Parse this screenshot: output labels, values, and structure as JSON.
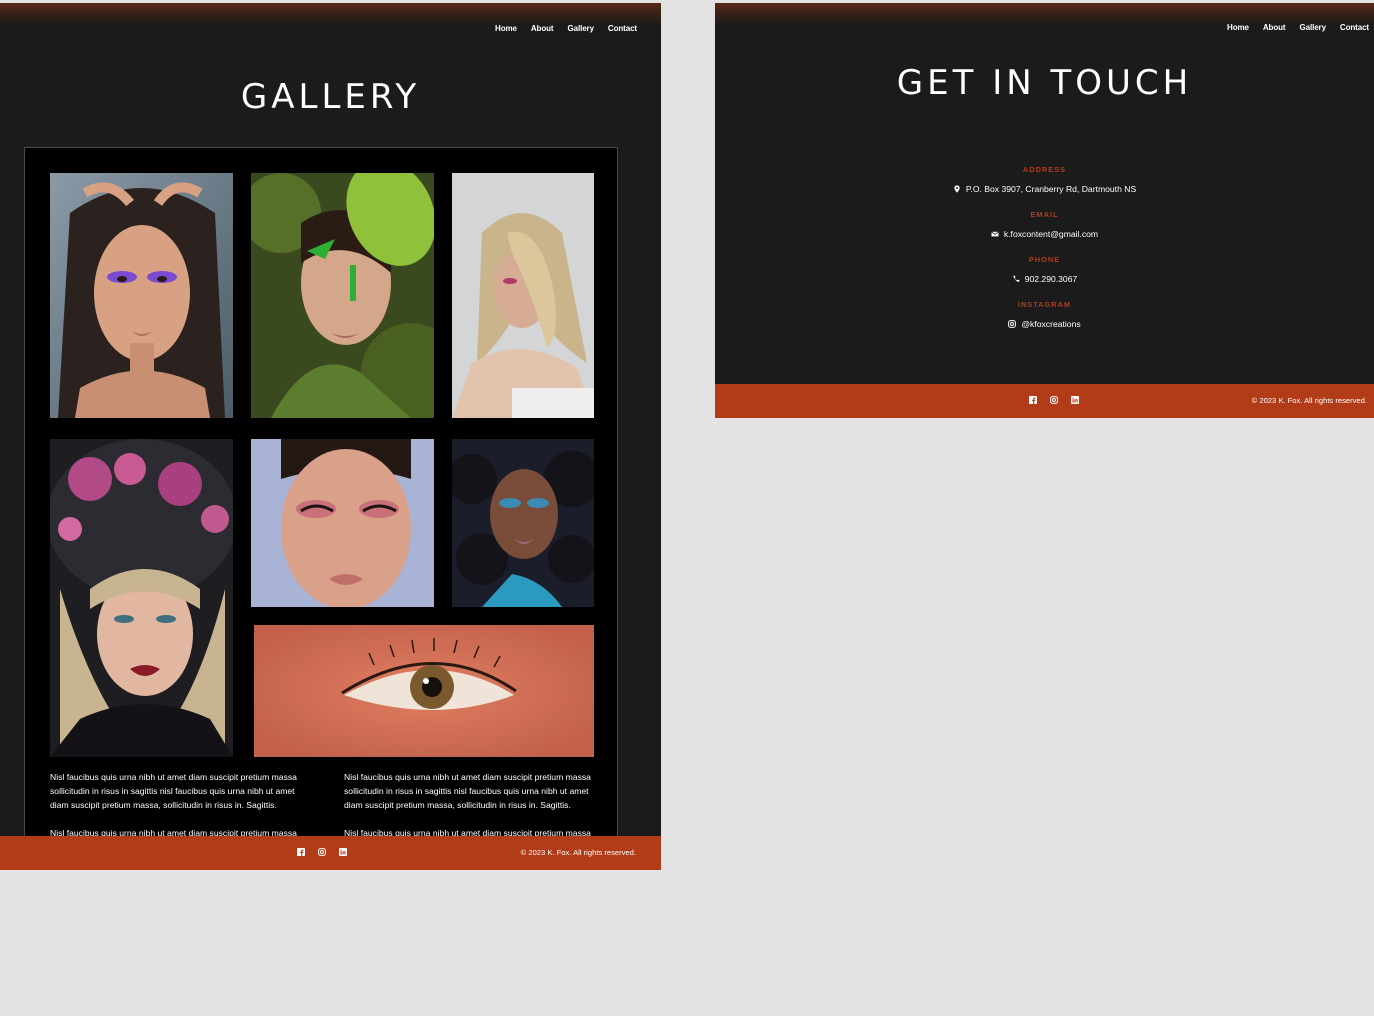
{
  "nav": {
    "items": [
      "Home",
      "About",
      "Gallery",
      "Contact"
    ]
  },
  "gallery_page": {
    "title": "GALLERY",
    "photos": [
      {
        "name": "portrait-purple-eyeshadow"
      },
      {
        "name": "portrait-green-leaf-paint"
      },
      {
        "name": "portrait-blonde-hair"
      },
      {
        "name": "portrait-flower-crown"
      },
      {
        "name": "portrait-pink-eyeshadow"
      },
      {
        "name": "portrait-curly-hair-blue-eyeshadow"
      },
      {
        "name": "closeup-orange-eye"
      }
    ],
    "captions": {
      "left_p1": "Nisl faucibus quis urna nibh ut amet diam suscipit pretium massa sollicitudin in risus in sagittis nisl faucibus quis urna nibh ut amet diam suscipit pretium massa, sollicitudin in risus in. Sagittis.",
      "left_p2": "Nisl faucibus quis urna nibh ut amet diam suscipit pretium massa sollicitudin in risus in sagittis nisl faucibus quis urna nibh ut amet diam suscipit pretium massa, sollicitudin in risus in. Sagittis.",
      "right_p1": "Nisl faucibus quis urna nibh ut amet diam suscipit pretium massa sollicitudin in risus in sagittis nisl faucibus quis urna nibh ut amet diam suscipit pretium massa, sollicitudin in risus in. Sagittis.",
      "right_p2": "Nisl faucibus quis urna nibh ut amet diam suscipit pretium massa sollicitudin in risus in sagittis nisl faucibus quis urna nibh ut amet diam suscipit pretium massa, sollicitudin in risus in. Sagittis."
    }
  },
  "contact_page": {
    "title": "GET IN TOUCH",
    "address": {
      "label": "ADDRESS",
      "value": "P.O. Box 3907, Cranberry Rd, Dartmouth NS",
      "icon": "map-pin-icon"
    },
    "email": {
      "label": "EMAIL",
      "value": "k.foxcontent@gmail.com",
      "icon": "envelope-icon"
    },
    "phone": {
      "label": "PHONE",
      "value": "902.290.3067",
      "icon": "phone-icon"
    },
    "instagram": {
      "label": "INSTAGRAM",
      "value": "@kfoxcreations",
      "icon": "instagram-icon"
    }
  },
  "footer": {
    "copyright": "© 2023 K. Fox. All rights reserved.",
    "social_icons": [
      "facebook-icon",
      "instagram-icon",
      "linkedin-icon"
    ]
  },
  "colors": {
    "background": "#1b1b1c",
    "accent": "#b33c18",
    "canvas": "#e3e3e3"
  }
}
